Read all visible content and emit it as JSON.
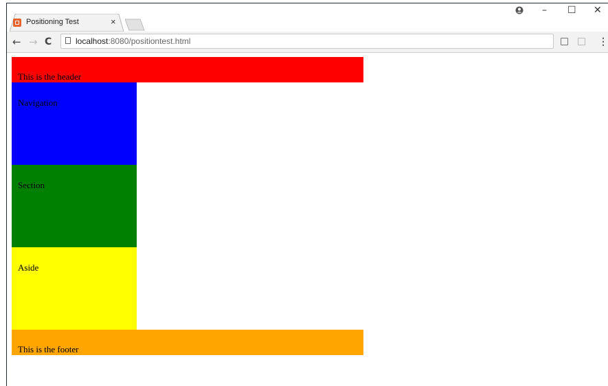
{
  "browser": {
    "tab": {
      "title": "Positioning Test",
      "close_glyph": "×",
      "favicon": "xampp-icon"
    },
    "window_controls": {
      "profile": "●",
      "minimize": "–",
      "maximize": "☐",
      "close": "✕"
    },
    "nav": {
      "back": "←",
      "forward": "→",
      "reload": "C"
    },
    "address": {
      "host": "localhost",
      "rest": ":8080/positiontest.html"
    },
    "menu": "⋮"
  },
  "page": {
    "header": "This is the header",
    "navigation": "Navigation",
    "section": "Section",
    "aside": "Aside",
    "footer": "This is the footer"
  },
  "colors": {
    "header": "#ff0000",
    "navigation": "#0000ff",
    "section": "#008000",
    "aside": "#ffff00",
    "footer": "#ffa500"
  }
}
